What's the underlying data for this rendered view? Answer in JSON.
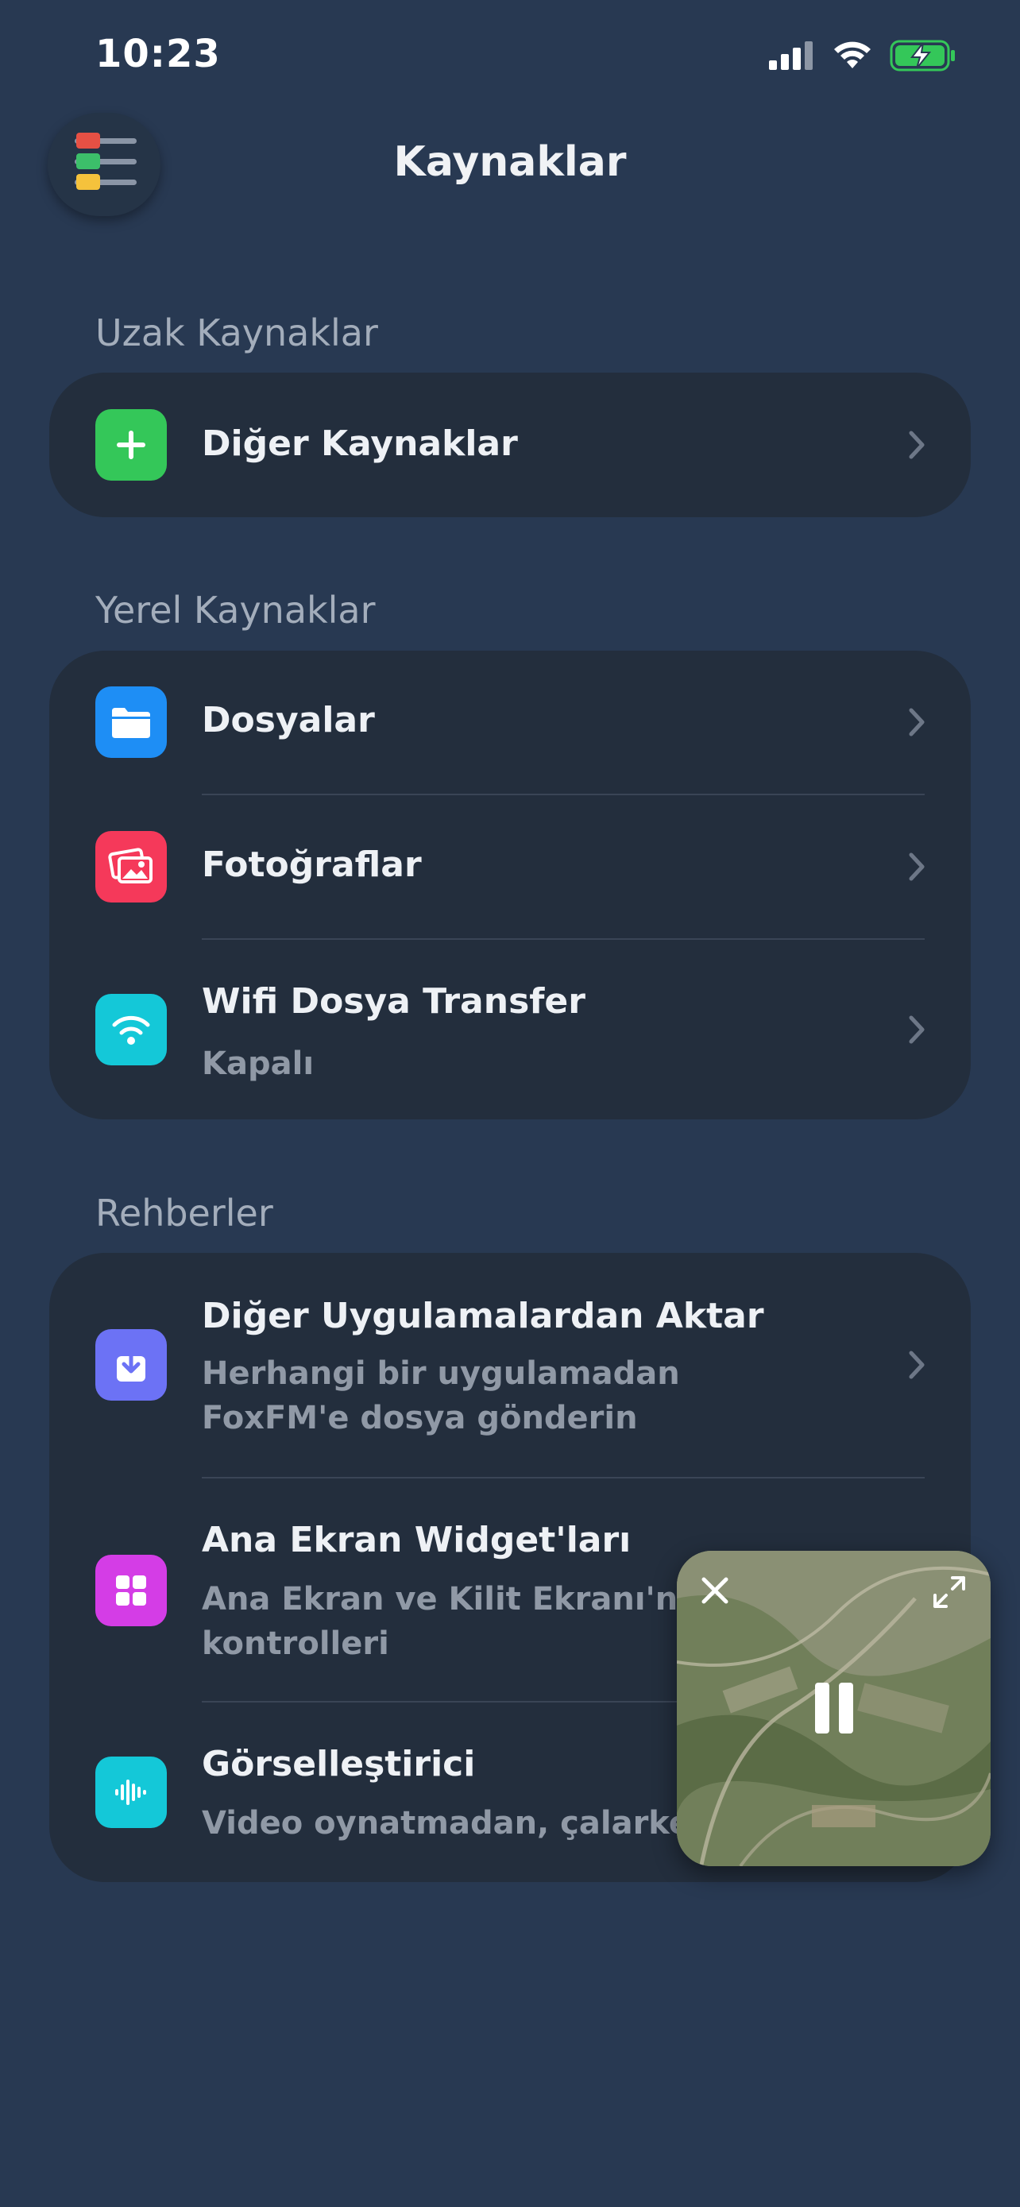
{
  "status_bar": {
    "time": "10:23"
  },
  "header": {
    "title": "Kaynaklar"
  },
  "sections": {
    "remote": {
      "title": "Uzak Kaynaklar",
      "items": [
        {
          "title": "Diğer Kaynaklar",
          "icon": "plus-icon",
          "color": "#34c759"
        }
      ]
    },
    "local": {
      "title": "Yerel Kaynaklar",
      "items": [
        {
          "title": "Dosyalar",
          "icon": "folder-icon",
          "color": "#1e8ef5"
        },
        {
          "title": "Fotoğraflar",
          "icon": "photos-icon",
          "color": "#f5395a"
        },
        {
          "title": "Wifi Dosya Transfer",
          "subtitle": "Kapalı",
          "icon": "wifi-icon",
          "color": "#14c8d8"
        }
      ]
    },
    "guides": {
      "title": "Rehberler",
      "items": [
        {
          "title": "Diğer Uygulamalardan Aktar",
          "subtitle": "Herhangi bir uygulamadan FoxFM'e dosya gönderin",
          "icon": "import-icon",
          "color": "#6c72f5"
        },
        {
          "title": "Ana Ekran Widget'ları",
          "subtitle": "Ana Ekran ve Kilit Ekranı'nda o kontrolleri",
          "icon": "widgets-icon",
          "color": "#d43de6"
        },
        {
          "title": "Görselleştirici",
          "subtitle": "Video oynatmadan, çalarken m",
          "icon": "waveform-icon",
          "color": "#14c8d8"
        }
      ]
    }
  },
  "pip": {
    "state": "playing"
  }
}
